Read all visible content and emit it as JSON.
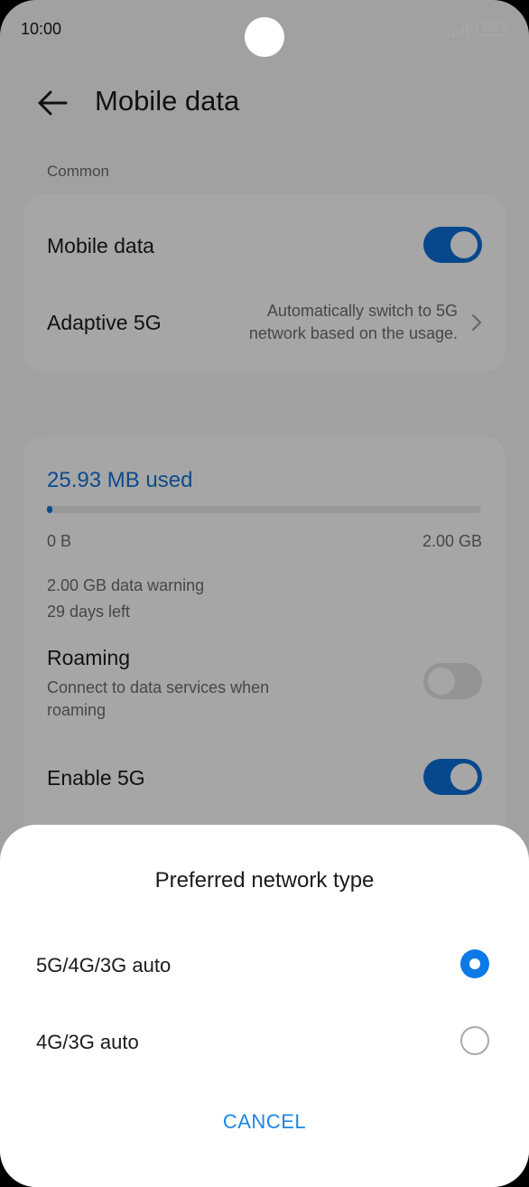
{
  "status_bar": {
    "time": "10:00",
    "battery": "100"
  },
  "header": {
    "title": "Mobile data"
  },
  "common": {
    "section_label": "Common",
    "mobile_data_label": "Mobile data",
    "mobile_data_on": true,
    "adaptive_label": "Adaptive 5G",
    "adaptive_desc_line1": "Automatically switch to 5G",
    "adaptive_desc_line2": "network based on the usage."
  },
  "usage": {
    "used_text": "25.93 MB used",
    "fraction_used": 0.0127,
    "min_label": "0 B",
    "max_label": "2.00 GB",
    "warning": "2.00 GB data warning",
    "days_left": "29 days left"
  },
  "roaming": {
    "label": "Roaming",
    "desc_line1": "Connect to data services when",
    "desc_line2": "roaming",
    "on": false
  },
  "enable5g": {
    "label": "Enable 5G",
    "on": true
  },
  "sheet": {
    "title": "Preferred network type",
    "options": [
      {
        "label": "5G/4G/3G auto",
        "selected": true
      },
      {
        "label": "4G/3G auto",
        "selected": false
      }
    ],
    "cancel": "CANCEL"
  },
  "colors": {
    "accent": "#0b7ae6",
    "link": "#1374d6"
  }
}
